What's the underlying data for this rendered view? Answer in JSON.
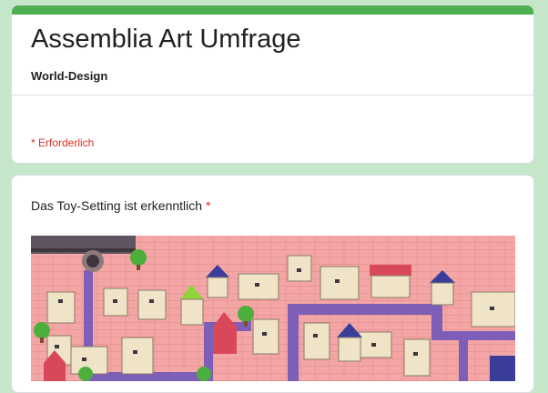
{
  "form": {
    "title": "Assemblia Art Umfrage",
    "subtitle": "World-Design",
    "required_note": "* Erforderlich"
  },
  "question": {
    "text": "Das Toy-Setting ist erkenntlich",
    "required_star": "*",
    "image_icon": "game-map-image"
  },
  "colors": {
    "accent": "#4caf50",
    "page_bg": "#c6e6c9",
    "required": "#d93025",
    "map_ground": "#f4a6a6",
    "map_path": "#7d5fb8"
  }
}
